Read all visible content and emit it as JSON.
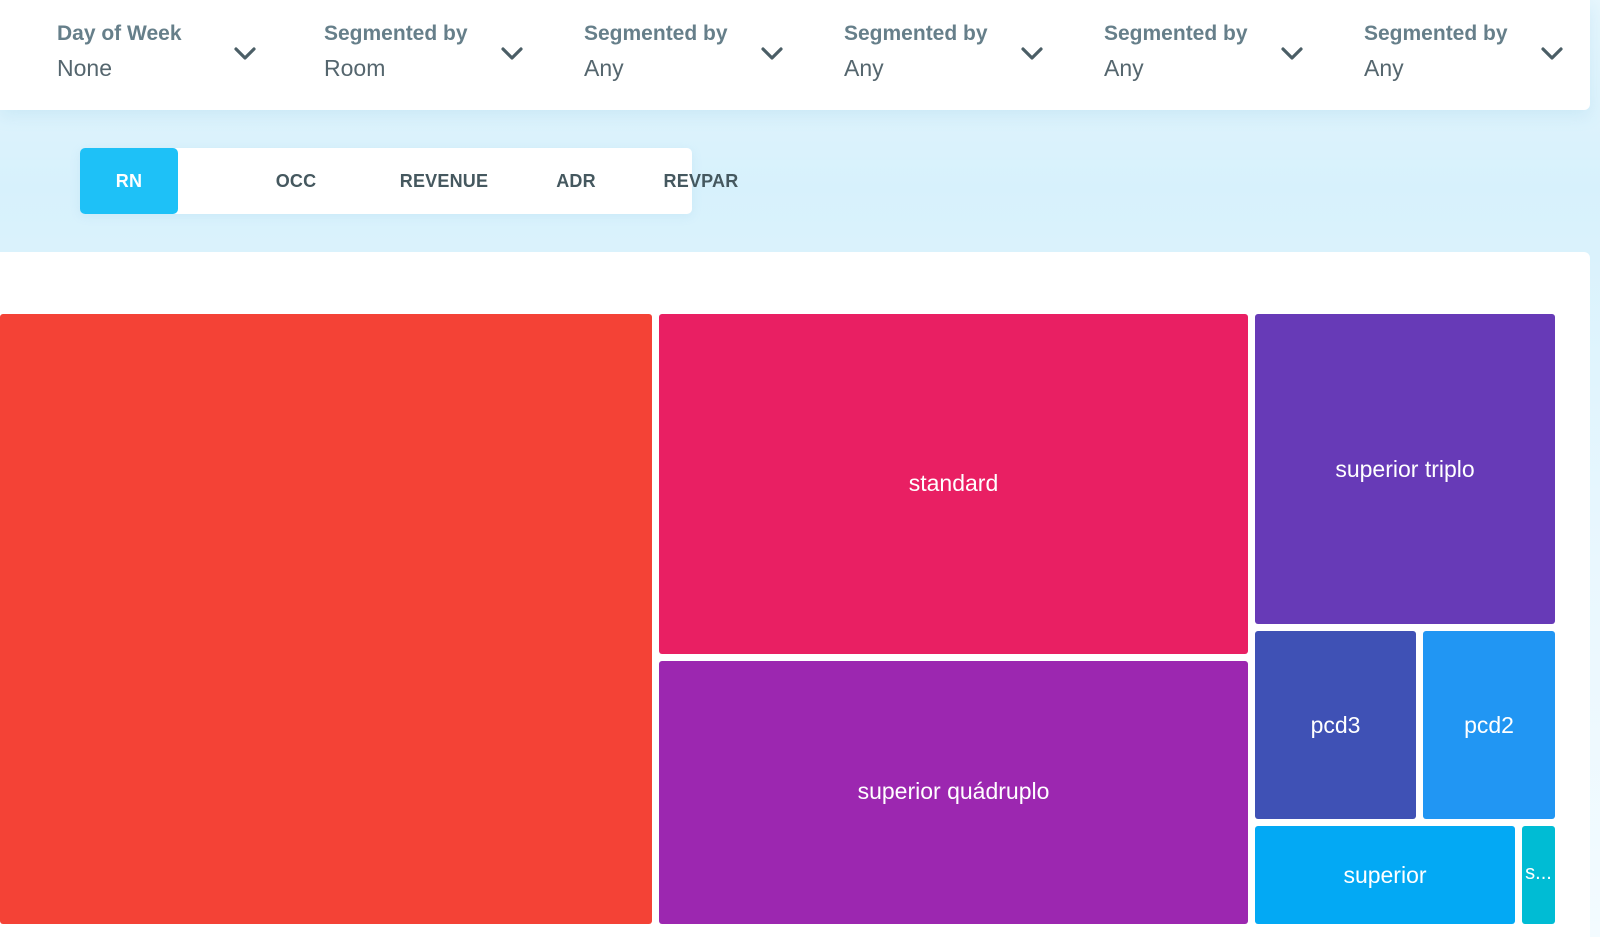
{
  "filters": [
    {
      "label": "Day of Week",
      "value": "None"
    },
    {
      "label": "Segmented by",
      "value": "Room"
    },
    {
      "label": "Segmented by",
      "value": "Any"
    },
    {
      "label": "Segmented by",
      "value": "Any"
    },
    {
      "label": "Segmented by",
      "value": "Any"
    },
    {
      "label": "Segmented by",
      "value": "Any"
    }
  ],
  "tabs": [
    {
      "label": "RN",
      "active": true
    },
    {
      "label": "OCC",
      "active": false
    },
    {
      "label": "REVENUE",
      "active": false
    },
    {
      "label": "ADR",
      "active": false
    },
    {
      "label": "REVPAR",
      "active": false
    }
  ],
  "colors": {
    "accent": "#1ec1f7"
  },
  "treemap": {
    "tiles": [
      {
        "label": "",
        "color": "#f44236"
      },
      {
        "label": "standard",
        "color": "#e91f63"
      },
      {
        "label": "superior quádruplo",
        "color": "#9c27b0"
      },
      {
        "label": "superior triplo",
        "color": "#673ab7"
      },
      {
        "label": "pcd3",
        "color": "#3f51b5"
      },
      {
        "label": "pcd2",
        "color": "#2196f3"
      },
      {
        "label": "superior",
        "color": "#03a9f4"
      },
      {
        "label": "s...",
        "color": "#00bcd4"
      }
    ]
  }
}
